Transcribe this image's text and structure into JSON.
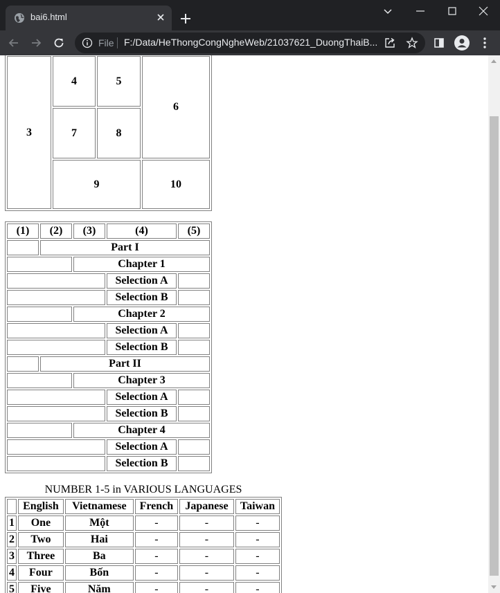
{
  "browser": {
    "tab_title": "bai6.html",
    "url_scheme": "File",
    "url": "F:/Data/HeThongCongNgheWeb/21037621_DuongThaiB..."
  },
  "grid_table": {
    "cells": [
      "3",
      "4",
      "5",
      "6",
      "7",
      "8",
      "9",
      "10"
    ]
  },
  "outline_table": {
    "header": [
      "(1)",
      "(2)",
      "(3)",
      "(4)",
      "(5)"
    ],
    "part1": "Part I",
    "part2": "Part II",
    "chapter1": "Chapter 1",
    "chapter2": "Chapter 2",
    "chapter3": "Chapter 3",
    "chapter4": "Chapter 4",
    "selection_a": "Selection A",
    "selection_b": "Selection B"
  },
  "numbers_table": {
    "caption": "NUMBER 1-5 in VARIOUS LANGUAGES",
    "headers": [
      "English",
      "Vietnamese",
      "French",
      "Japanese",
      "Taiwan"
    ],
    "rows": [
      {
        "num": "1",
        "english": "One",
        "vietnamese": "Một",
        "french": "-",
        "japanese": "-",
        "taiwan": "-"
      },
      {
        "num": "2",
        "english": "Two",
        "vietnamese": "Hai",
        "french": "-",
        "japanese": "-",
        "taiwan": "-"
      },
      {
        "num": "3",
        "english": "Three",
        "vietnamese": "Ba",
        "french": "-",
        "japanese": "-",
        "taiwan": "-"
      },
      {
        "num": "4",
        "english": "Four",
        "vietnamese": "Bốn",
        "french": "-",
        "japanese": "-",
        "taiwan": "-"
      },
      {
        "num": "5",
        "english": "Five",
        "vietnamese": "Năm",
        "french": "-",
        "japanese": "-",
        "taiwan": "-"
      }
    ]
  }
}
